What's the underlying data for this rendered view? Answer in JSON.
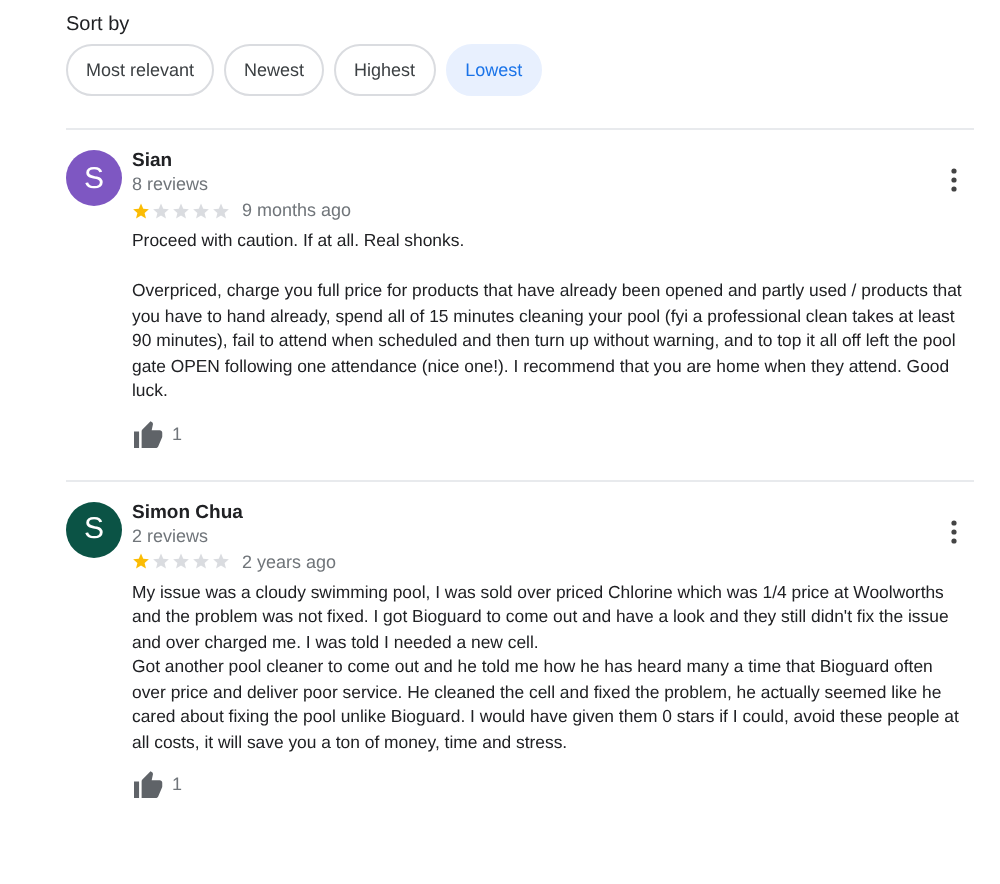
{
  "sort": {
    "label": "Sort by",
    "options": [
      {
        "label": "Most relevant",
        "selected": false
      },
      {
        "label": "Newest",
        "selected": false
      },
      {
        "label": "Highest",
        "selected": false
      },
      {
        "label": "Lowest",
        "selected": true
      }
    ]
  },
  "reviews": [
    {
      "initial": "S",
      "color": "#7e57c2",
      "name": "Sian",
      "count": "8 reviews",
      "stars": 1,
      "time": "9 months ago",
      "text": "Proceed with caution. If at all. Real shonks.\n\nOverpriced, charge you full price for products that have already been opened and partly used / products that you have to hand already, spend all of 15 minutes cleaning your pool (fyi a professional clean takes at least 90 minutes), fail to attend when scheduled and then turn up without warning, and to top it all off left the pool gate OPEN following one attendance (nice one!). I recommend that you are home when they attend. Good luck.",
      "likes": "1"
    },
    {
      "initial": "S",
      "color": "#0b5345",
      "name": "Simon Chua",
      "count": "2 reviews",
      "stars": 1,
      "time": "2 years ago",
      "text": "My issue was a cloudy swimming pool, I was sold over priced Chlorine which was 1/4 price at Woolworths and the problem was not fixed. I got Bioguard to come out and have a look and they still didn't fix the issue and over charged me.  I was told I needed a new cell.\nGot another pool cleaner to come out and he told me how he has heard many a time that Bioguard often over price and deliver poor service.   He cleaned the cell and fixed the problem, he actually seemed like he cared about fixing the pool unlike Bioguard.  I would have given them 0 stars if I could, avoid these people at all costs, it will save you a ton of money, time and stress.",
      "likes": "1"
    }
  ]
}
